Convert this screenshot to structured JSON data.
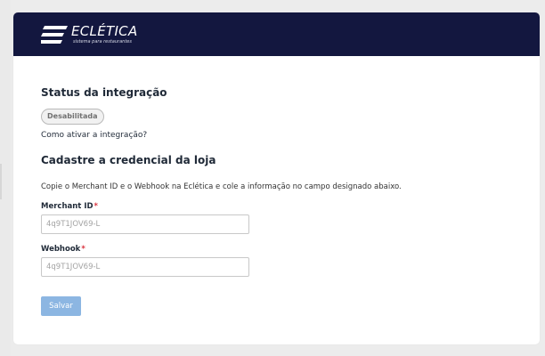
{
  "brand": {
    "name": "ECLÉTICA",
    "tagline": "sistema para restaurantes",
    "header_color": "#13173f"
  },
  "status": {
    "title": "Status da integração",
    "badge": "Desabilitada",
    "how_to_link": "Como ativar a integração?"
  },
  "credentials": {
    "title": "Cadastre a credencial da loja",
    "description": "Copie o Merchant ID e o Webhook na Eclética e cole a informação no campo designado abaixo.",
    "merchant": {
      "label": "Merchant ID",
      "required_mark": "*",
      "placeholder": "4q9T1JOV69-L",
      "value": ""
    },
    "webhook": {
      "label": "Webhook",
      "required_mark": "*",
      "placeholder": "4q9T1JOV69-L",
      "value": ""
    },
    "save_button": "Salvar",
    "save_button_color": "#8cb6e2"
  }
}
